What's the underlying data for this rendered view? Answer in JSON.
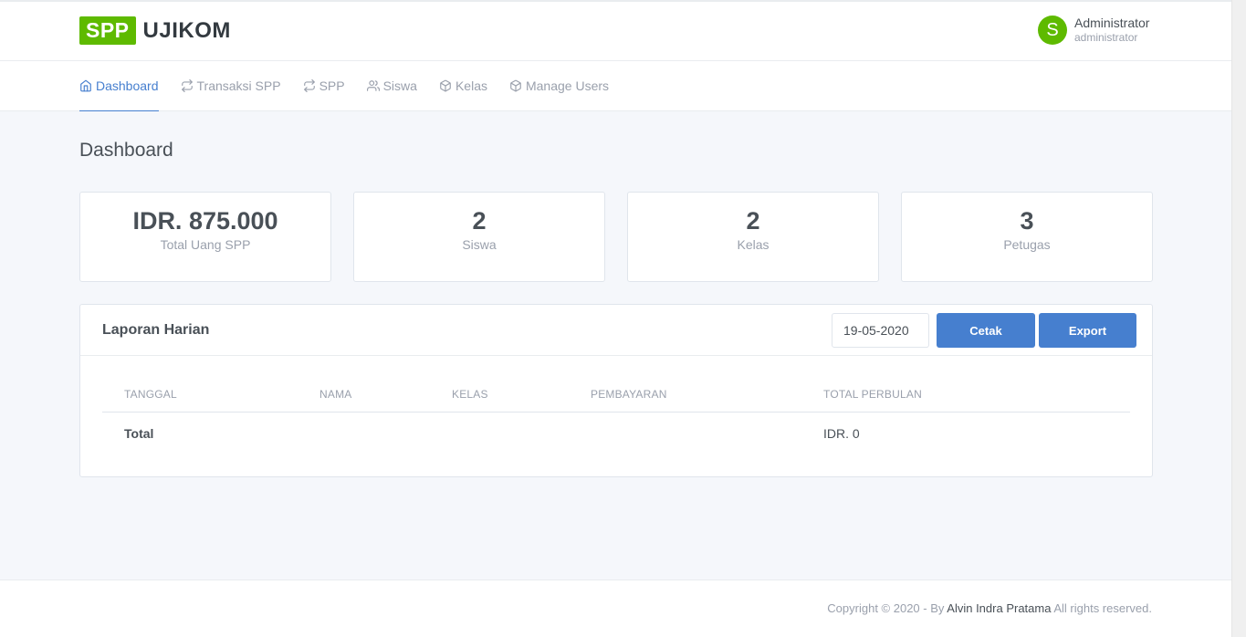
{
  "brand": {
    "box": "SPP",
    "text": "UJIKOM",
    "color": "#5eba00"
  },
  "user": {
    "initial": "S",
    "name": "Administrator",
    "role": "administrator"
  },
  "nav": {
    "items": [
      {
        "label": "Dashboard",
        "icon": "home-icon",
        "active": true
      },
      {
        "label": "Transaksi SPP",
        "icon": "repeat-icon"
      },
      {
        "label": "SPP",
        "icon": "repeat-icon"
      },
      {
        "label": "Siswa",
        "icon": "users-icon"
      },
      {
        "label": "Kelas",
        "icon": "box-icon"
      },
      {
        "label": "Manage Users",
        "icon": "box-icon"
      }
    ]
  },
  "page": {
    "title": "Dashboard"
  },
  "stats": [
    {
      "value": "IDR. 875.000",
      "label": "Total Uang SPP"
    },
    {
      "value": "2",
      "label": "Siswa"
    },
    {
      "value": "2",
      "label": "Kelas"
    },
    {
      "value": "3",
      "label": "Petugas"
    }
  ],
  "report": {
    "title": "Laporan Harian",
    "date_value": "19-05-2020",
    "cetak_label": "Cetak",
    "export_label": "Export",
    "columns": [
      "TANGGAL",
      "NAMA",
      "KELAS",
      "PEMBAYARAN",
      "TOTAL PERBULAN"
    ],
    "total_label": "Total",
    "total_value": "IDR. 0"
  },
  "footer": {
    "prefix": "Copyright © 2020 - By ",
    "author": "Alvin Indra Pratama",
    "suffix": " All rights reserved."
  },
  "colors": {
    "accent": "#467fcf",
    "brand_green": "#5eba00"
  }
}
